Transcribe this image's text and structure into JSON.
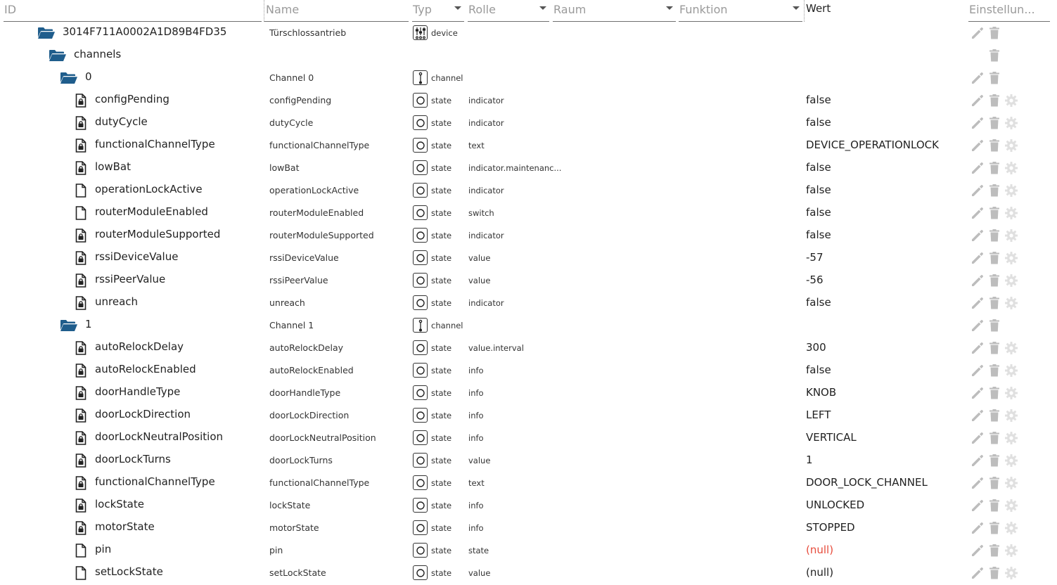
{
  "header": {
    "id": "ID",
    "name": "Name",
    "typ": "Typ",
    "rolle": "Rolle",
    "raum": "Raum",
    "funktion": "Funktion",
    "wert": "Wert",
    "einstellungen": "Einstellun..."
  },
  "colors": {
    "null_value": "#e74c3c",
    "icon": "#bdbdbd",
    "folder": "#1f5d8c"
  },
  "rows": [
    {
      "kind": "folder",
      "level": 0,
      "id": "3014F711A0002A1D89B4FD35",
      "name": "Türschlossantrieb",
      "typ": "device",
      "typ_icon": "device-icon",
      "role": "",
      "value": "",
      "actions": [
        "edit",
        "delete"
      ]
    },
    {
      "kind": "folder",
      "level": 1,
      "id": "channels",
      "name": "",
      "typ": "",
      "role": "",
      "value": "",
      "actions": [
        "delete"
      ]
    },
    {
      "kind": "folder",
      "level": 2,
      "id": "0",
      "name": "Channel 0",
      "typ": "channel",
      "typ_icon": "channel-icon",
      "role": "",
      "value": "",
      "actions": [
        "edit",
        "delete"
      ]
    },
    {
      "kind": "state-ro",
      "level": 3,
      "id": "configPending",
      "name": "configPending",
      "typ": "state",
      "role": "indicator",
      "value": "false",
      "actions": [
        "edit",
        "delete",
        "gear"
      ]
    },
    {
      "kind": "state-ro",
      "level": 3,
      "id": "dutyCycle",
      "name": "dutyCycle",
      "typ": "state",
      "role": "indicator",
      "value": "false",
      "actions": [
        "edit",
        "delete",
        "gear"
      ]
    },
    {
      "kind": "state-ro",
      "level": 3,
      "id": "functionalChannelType",
      "name": "functionalChannelType",
      "typ": "state",
      "role": "text",
      "value": "DEVICE_OPERATIONLOCK",
      "actions": [
        "edit",
        "delete",
        "gear"
      ]
    },
    {
      "kind": "state-ro",
      "level": 3,
      "id": "lowBat",
      "name": "lowBat",
      "typ": "state",
      "role": "indicator.maintenanc...",
      "value": "false",
      "actions": [
        "edit",
        "delete",
        "gear"
      ]
    },
    {
      "kind": "state",
      "level": 3,
      "id": "operationLockActive",
      "name": "operationLockActive",
      "typ": "state",
      "role": "indicator",
      "value": "false",
      "actions": [
        "edit",
        "delete",
        "gear"
      ]
    },
    {
      "kind": "state",
      "level": 3,
      "id": "routerModuleEnabled",
      "name": "routerModuleEnabled",
      "typ": "state",
      "role": "switch",
      "value": "false",
      "actions": [
        "edit",
        "delete",
        "gear"
      ]
    },
    {
      "kind": "state-ro",
      "level": 3,
      "id": "routerModuleSupported",
      "name": "routerModuleSupported",
      "typ": "state",
      "role": "indicator",
      "value": "false",
      "actions": [
        "edit",
        "delete",
        "gear"
      ]
    },
    {
      "kind": "state-ro",
      "level": 3,
      "id": "rssiDeviceValue",
      "name": "rssiDeviceValue",
      "typ": "state",
      "role": "value",
      "value": "-57",
      "actions": [
        "edit",
        "delete",
        "gear"
      ]
    },
    {
      "kind": "state-ro",
      "level": 3,
      "id": "rssiPeerValue",
      "name": "rssiPeerValue",
      "typ": "state",
      "role": "value",
      "value": "-56",
      "actions": [
        "edit",
        "delete",
        "gear"
      ]
    },
    {
      "kind": "state-ro",
      "level": 3,
      "id": "unreach",
      "name": "unreach",
      "typ": "state",
      "role": "indicator",
      "value": "false",
      "actions": [
        "edit",
        "delete",
        "gear"
      ]
    },
    {
      "kind": "folder",
      "level": 2,
      "id": "1",
      "name": "Channel 1",
      "typ": "channel",
      "typ_icon": "channel-icon",
      "role": "",
      "value": "",
      "actions": [
        "edit",
        "delete"
      ]
    },
    {
      "kind": "state-ro",
      "level": 3,
      "id": "autoRelockDelay",
      "name": "autoRelockDelay",
      "typ": "state",
      "role": "value.interval",
      "value": "300",
      "actions": [
        "edit",
        "delete",
        "gear"
      ]
    },
    {
      "kind": "state-ro",
      "level": 3,
      "id": "autoRelockEnabled",
      "name": "autoRelockEnabled",
      "typ": "state",
      "role": "info",
      "value": "false",
      "actions": [
        "edit",
        "delete",
        "gear"
      ]
    },
    {
      "kind": "state-ro",
      "level": 3,
      "id": "doorHandleType",
      "name": "doorHandleType",
      "typ": "state",
      "role": "info",
      "value": "KNOB",
      "actions": [
        "edit",
        "delete",
        "gear"
      ]
    },
    {
      "kind": "state-ro",
      "level": 3,
      "id": "doorLockDirection",
      "name": "doorLockDirection",
      "typ": "state",
      "role": "info",
      "value": "LEFT",
      "actions": [
        "edit",
        "delete",
        "gear"
      ]
    },
    {
      "kind": "state-ro",
      "level": 3,
      "id": "doorLockNeutralPosition",
      "name": "doorLockNeutralPosition",
      "typ": "state",
      "role": "info",
      "value": "VERTICAL",
      "actions": [
        "edit",
        "delete",
        "gear"
      ]
    },
    {
      "kind": "state-ro",
      "level": 3,
      "id": "doorLockTurns",
      "name": "doorLockTurns",
      "typ": "state",
      "role": "value",
      "value": "1",
      "actions": [
        "edit",
        "delete",
        "gear"
      ]
    },
    {
      "kind": "state-ro",
      "level": 3,
      "id": "functionalChannelType",
      "name": "functionalChannelType",
      "typ": "state",
      "role": "text",
      "value": "DOOR_LOCK_CHANNEL",
      "actions": [
        "edit",
        "delete",
        "gear"
      ]
    },
    {
      "kind": "state-ro",
      "level": 3,
      "id": "lockState",
      "name": "lockState",
      "typ": "state",
      "role": "info",
      "value": "UNLOCKED",
      "actions": [
        "edit",
        "delete",
        "gear"
      ]
    },
    {
      "kind": "state-ro",
      "level": 3,
      "id": "motorState",
      "name": "motorState",
      "typ": "state",
      "role": "info",
      "value": "STOPPED",
      "actions": [
        "edit",
        "delete",
        "gear"
      ]
    },
    {
      "kind": "state",
      "level": 3,
      "id": "pin",
      "name": "pin",
      "typ": "state",
      "role": "state",
      "value": "(null)",
      "value_red": true,
      "actions": [
        "edit",
        "delete",
        "gear"
      ]
    },
    {
      "kind": "state",
      "level": 3,
      "id": "setLockState",
      "name": "setLockState",
      "typ": "state",
      "role": "value",
      "value": "(null)",
      "actions": [
        "edit",
        "delete",
        "gear"
      ]
    }
  ]
}
